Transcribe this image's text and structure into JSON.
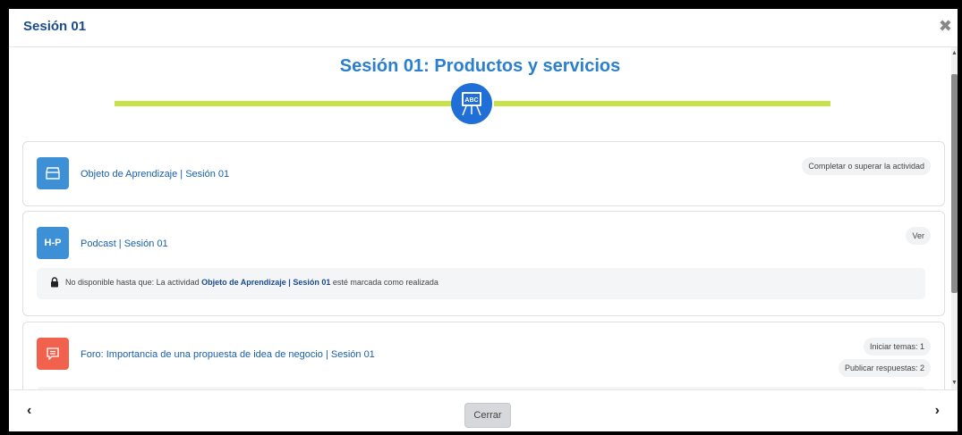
{
  "modal": {
    "title": "Sesión 01",
    "close_glyph": "✖"
  },
  "section": {
    "title": "Sesión 01: Productos y servicios",
    "deco_icon": "chalkboard-abc-icon",
    "deco_icon_text": "ABC",
    "line_color": "#c8e24a",
    "circle_color": "#1f6fd6"
  },
  "activities": [
    {
      "icon": "box-icon",
      "icon_color": "#3d8fd6",
      "name": "Objeto de Aprendizaje | Sesión 01",
      "badges": [
        "Completar o superar la actividad"
      ]
    },
    {
      "icon": "h5p-icon",
      "icon_text": "H-P",
      "icon_color": "#3d8fd6",
      "name": "Podcast | Sesión 01",
      "badges": [
        "Ver"
      ],
      "restriction": {
        "prefix": "No disponible hasta que: La actividad",
        "link": "Objeto de Aprendizaje | Sesión 01",
        "suffix": "esté marcada como realizada"
      }
    },
    {
      "icon": "forum-icon",
      "icon_color": "#f0624d",
      "name": "Foro: Importancia de una propuesta de idea de negocio | Sesión 01",
      "badges": [
        "Iniciar temas: 1",
        "Publicar respuestas: 2"
      ]
    }
  ],
  "footer": {
    "prev_glyph": "‹",
    "next_glyph": "›",
    "close_label": "Cerrar"
  }
}
